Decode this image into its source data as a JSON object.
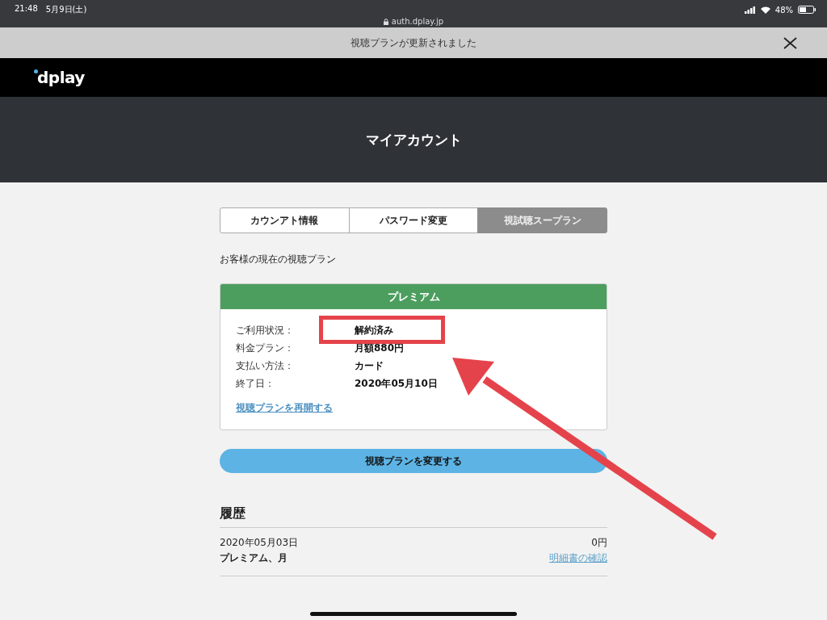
{
  "status_bar": {
    "time": "21:48",
    "date": "5月9日(土)",
    "url": "auth.dplay.jp",
    "battery": "48%"
  },
  "banner": {
    "message": "視聴プランが更新されました"
  },
  "nav": {
    "logo": "dplay"
  },
  "header": {
    "title": "マイアカウント"
  },
  "tabs": [
    {
      "label": "カウンアト情報",
      "selected": false
    },
    {
      "label": "パスワード変更",
      "selected": false
    },
    {
      "label": "視試聴スープラン",
      "selected": true
    }
  ],
  "intro": "お客様の現在の視聴プラン",
  "plan": {
    "name": "プレミアム",
    "rows": [
      {
        "label": "ご利用状況：",
        "value": "解約済み"
      },
      {
        "label": "料金プラン：",
        "value": "月額880円"
      },
      {
        "label": "支払い方法：",
        "value": "カード"
      },
      {
        "label": "終了日：",
        "value": "2020年05月10日"
      }
    ],
    "link": "視聴プランを再開する"
  },
  "change_button": "視聴プランを変更する",
  "history": {
    "title": "履歴",
    "items": [
      {
        "date": "2020年05月03日",
        "amount": "0円",
        "plan": "プレミアム、月",
        "link": "明細書の確認"
      }
    ]
  }
}
